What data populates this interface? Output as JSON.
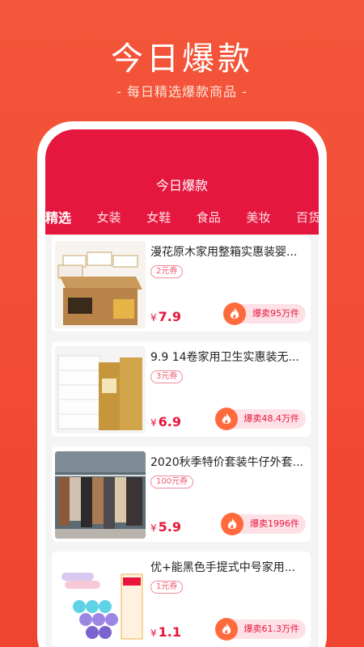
{
  "hero": {
    "title": "今日爆款",
    "subtitle": "- 每日精选爆款商品 -"
  },
  "app": {
    "title": "今日爆款"
  },
  "tabs": [
    "精选",
    "女装",
    "女鞋",
    "食品",
    "美妆",
    "百货"
  ],
  "products": [
    {
      "title": "漫花原木家用整箱实惠装婴...",
      "coupon": "2元券",
      "currency": "¥",
      "price": "7.9",
      "sold": "爆卖95万件",
      "image": "tissue-box"
    },
    {
      "title": "9.9 14卷家用卫生实惠装无...",
      "coupon": "3元券",
      "currency": "¥",
      "price": "6.9",
      "sold": "爆卖48.4万件",
      "image": "toilet-paper"
    },
    {
      "title": "2020秋季特价套装牛仔外套...",
      "coupon": "100元券",
      "currency": "¥",
      "price": "5.9",
      "sold": "爆卖1996件",
      "image": "clothes-rack"
    },
    {
      "title": "优+能黑色手提式中号家用...",
      "coupon": "1元券",
      "currency": "¥",
      "price": "1.1",
      "sold": "爆卖61.3万件",
      "image": "trash-bags"
    }
  ],
  "colors": {
    "brand_red": "#e5173f",
    "page_orange": "#f24a34",
    "fire": "#ff6a3c"
  }
}
